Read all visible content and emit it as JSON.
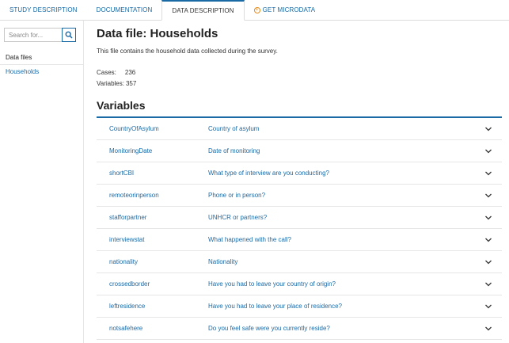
{
  "tabs": [
    {
      "label": "STUDY DESCRIPTION"
    },
    {
      "label": "DOCUMENTATION"
    },
    {
      "label": "DATA DESCRIPTION"
    },
    {
      "label": "GET MICRODATA"
    }
  ],
  "sidebar": {
    "search_placeholder": "Search for...",
    "heading": "Data files",
    "items": [
      {
        "label": "Households"
      }
    ]
  },
  "main": {
    "title": "Data file: Households",
    "description": "This file contains the household data collected during the survey.",
    "cases_label": "Cases:",
    "cases_value": "236",
    "variables_label": "Variables:",
    "variables_value": "357",
    "variables_heading": "Variables"
  },
  "variables": [
    {
      "name": "CountryOfAsylum",
      "label": "Country of asylum"
    },
    {
      "name": "MonitoringDate",
      "label": "Date of monitoring"
    },
    {
      "name": "shortCBI",
      "label": "What type of interview are you conducting?"
    },
    {
      "name": "remoteorinperson",
      "label": "Phone or in person?"
    },
    {
      "name": "stafforpartner",
      "label": "UNHCR or partners?"
    },
    {
      "name": "interviewstat",
      "label": "What happened with the call?"
    },
    {
      "name": "nationality",
      "label": "Nationality"
    },
    {
      "name": "crossedborder",
      "label": "Have you had to leave your country of origin?"
    },
    {
      "name": "leftresidence",
      "label": "Have you had to leave your place of residence?"
    },
    {
      "name": "notsafehere",
      "label": "Do you feel safe were you currently reside?"
    }
  ],
  "colors": {
    "accent": "#1a6aa6",
    "microdata_icon": "#e38b1d"
  }
}
